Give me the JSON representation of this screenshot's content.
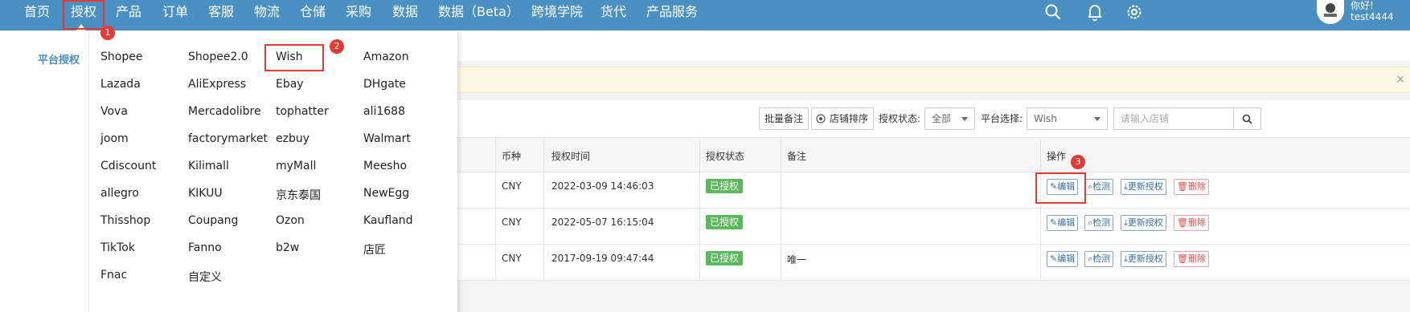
{
  "nav": {
    "items": [
      "首页",
      "授权",
      "产品",
      "订单",
      "客服",
      "物流",
      "仓储",
      "采购",
      "数据",
      "数据（Beta）",
      "跨境学院",
      "货代",
      "产品服务"
    ],
    "active": "授权",
    "greeting": "你好!",
    "username": "test4444",
    "icons": [
      "search-icon",
      "bell-icon",
      "gear-icon"
    ]
  },
  "callouts": [
    "1",
    "2",
    "3"
  ],
  "dropdown": {
    "section_label": "平台授权",
    "platforms": [
      [
        "Shopee",
        "Shopee2.0",
        "Wish",
        "Amazon"
      ],
      [
        "Lazada",
        "AliExpress",
        "Ebay",
        "DHgate"
      ],
      [
        "Vova",
        "Mercadolibre",
        "tophatter",
        "ali1688"
      ],
      [
        "joom",
        "factorymarket",
        "ezbuy",
        "Walmart"
      ],
      [
        "Cdiscount",
        "Kilimall",
        "myMall",
        "Meesho"
      ],
      [
        "allegro",
        "KIKUU",
        "京东泰国",
        "NewEgg"
      ],
      [
        "Thisshop",
        "Coupang",
        "Ozon",
        "Kaufland"
      ],
      [
        "TikTok",
        "Fanno",
        "b2w",
        "店匠"
      ],
      [
        "Fnac",
        "自定义",
        "",
        ""
      ]
    ]
  },
  "notice": {
    "close": "×"
  },
  "toolbar": {
    "batch_note": "批量备注",
    "store_sort": "店铺排序",
    "status_label": "授权状态:",
    "status_value": "全部",
    "platform_label": "平台选择:",
    "platform_value": "Wish",
    "search_placeholder": "请输入店铺"
  },
  "table": {
    "headers": [
      "币种",
      "授权时间",
      "授权状态",
      "备注",
      "操作"
    ],
    "rows": [
      {
        "currency": "CNY",
        "time": "2022-03-09 14:46:03",
        "status": "已授权",
        "note": ""
      },
      {
        "currency": "CNY",
        "time": "2022-05-07 16:15:04",
        "status": "已授权",
        "note": ""
      },
      {
        "currency": "CNY",
        "time": "2017-09-19 09:47:44",
        "status": "已授权",
        "note": "唯一"
      }
    ],
    "actions": {
      "edit": "编辑",
      "check": "检测",
      "reauth": "更新授权",
      "delete": "删除"
    }
  },
  "colors": {
    "nav_bg": "#4a90c2",
    "highlight": "#e53935",
    "status_green": "#5cb85c"
  }
}
